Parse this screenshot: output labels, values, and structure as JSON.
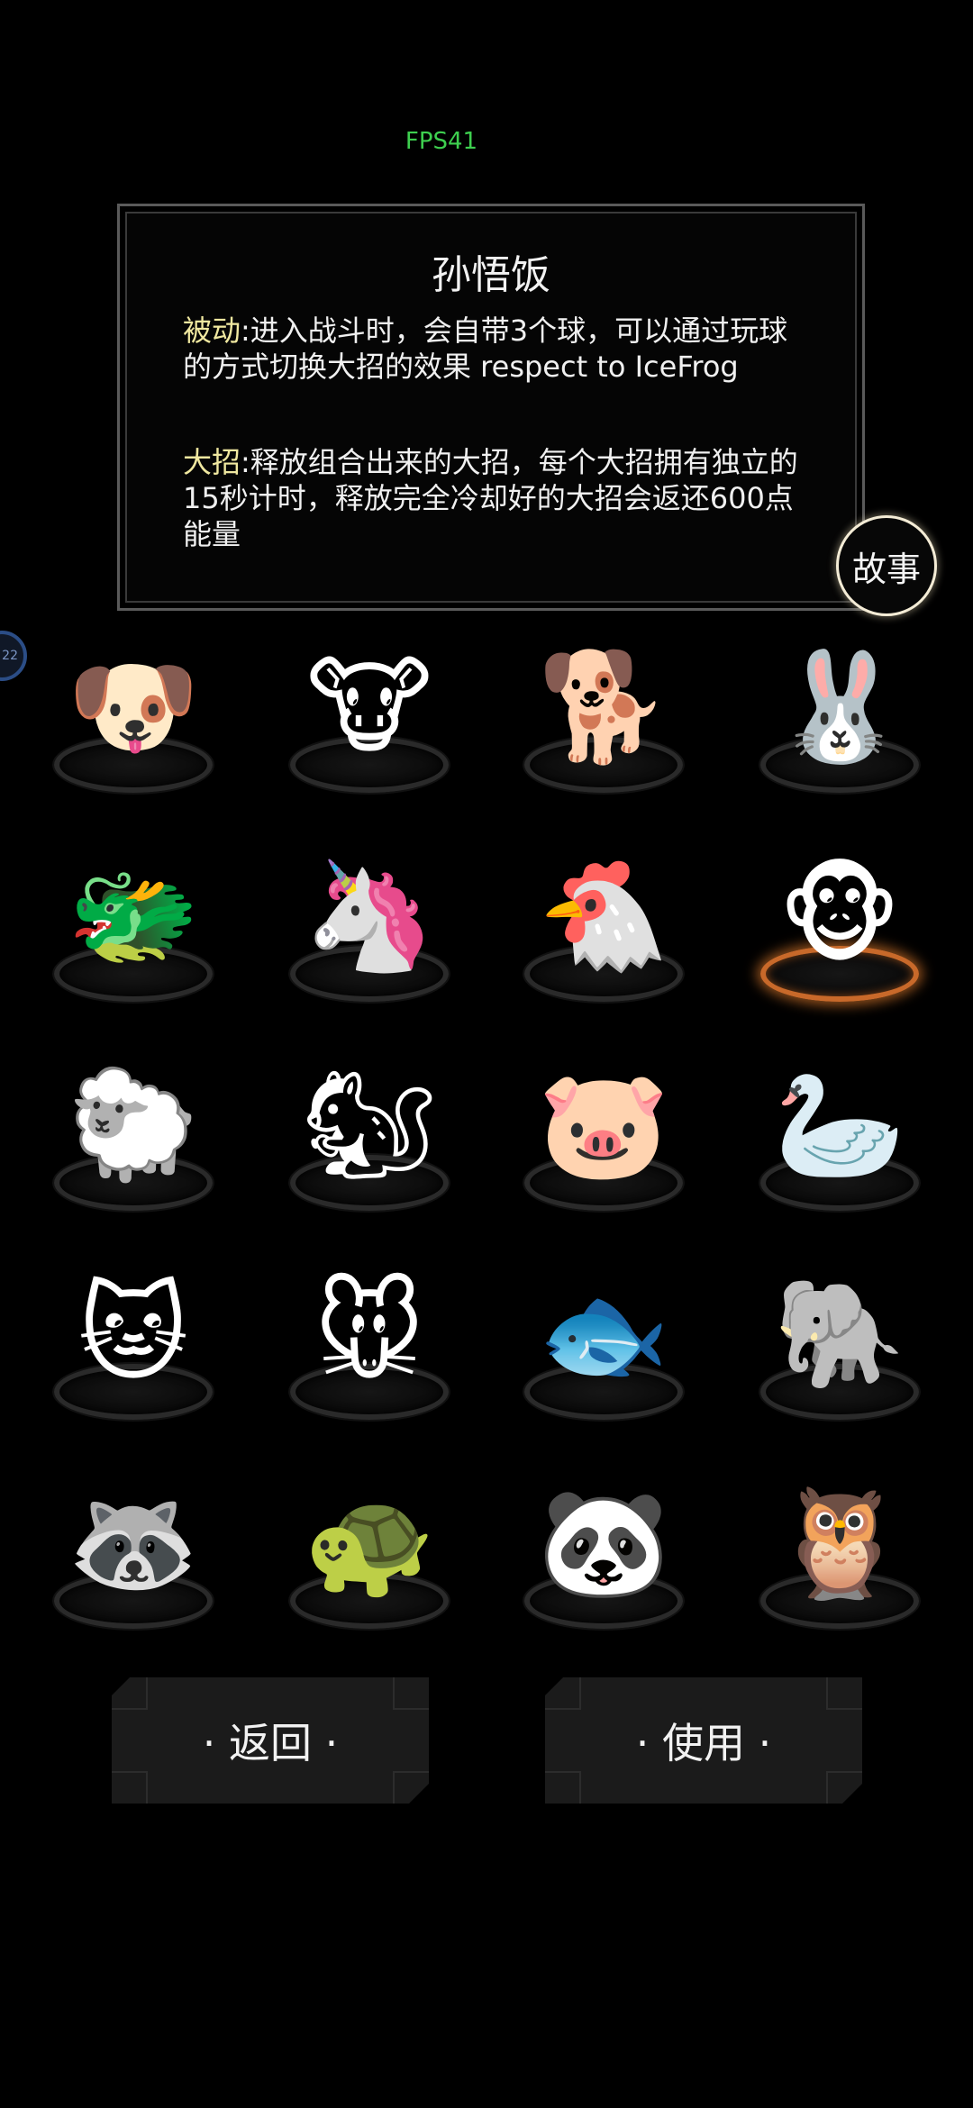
{
  "hud": {
    "fps": "FPS41"
  },
  "edge_badge": {
    "text": "22"
  },
  "info": {
    "title": "孙悟饭",
    "passive_tag": "被动",
    "passive_text": ":进入战斗时，会自带3个球，可以通过玩球的方式切换大招的效果          respect to IceFrog",
    "ultimate_tag": "大招",
    "ultimate_text": ":释放组合出来的大招，每个大招拥有独立的15秒计时，释放完全冷却好的大招会返还600点能量",
    "story_button": "故事"
  },
  "pets": [
    {
      "icon": "puppy-icon",
      "glyph": "🐶"
    },
    {
      "icon": "cow-icon",
      "glyph": "🐮"
    },
    {
      "icon": "spotted-puppy-icon",
      "glyph": "🐕"
    },
    {
      "icon": "rabbit-icon",
      "glyph": "🐰"
    },
    {
      "icon": "dragon-icon",
      "glyph": "🐲"
    },
    {
      "icon": "horse-icon",
      "glyph": "🦄"
    },
    {
      "icon": "rooster-icon",
      "glyph": "🐔"
    },
    {
      "icon": "monkey-icon",
      "glyph": "🐵",
      "selected": true
    },
    {
      "icon": "sheep-icon",
      "glyph": "🐑"
    },
    {
      "icon": "squirrel-icon",
      "glyph": "🐿"
    },
    {
      "icon": "pig-icon",
      "glyph": "🐷"
    },
    {
      "icon": "goose-icon",
      "glyph": "🦢"
    },
    {
      "icon": "cat-icon",
      "glyph": "🐱"
    },
    {
      "icon": "mouse-icon",
      "glyph": "🐭"
    },
    {
      "icon": "fish-icon",
      "glyph": "🐟"
    },
    {
      "icon": "elephant-icon",
      "glyph": "🐘"
    },
    {
      "icon": "raccoon-icon",
      "glyph": "🦝"
    },
    {
      "icon": "turtle-icon",
      "glyph": "🐢"
    },
    {
      "icon": "panda-icon",
      "glyph": "🐼"
    },
    {
      "icon": "owl-icon",
      "glyph": "🦉"
    }
  ],
  "buttons": {
    "back": "· 返回 ·",
    "use": "· 使用 ·"
  }
}
